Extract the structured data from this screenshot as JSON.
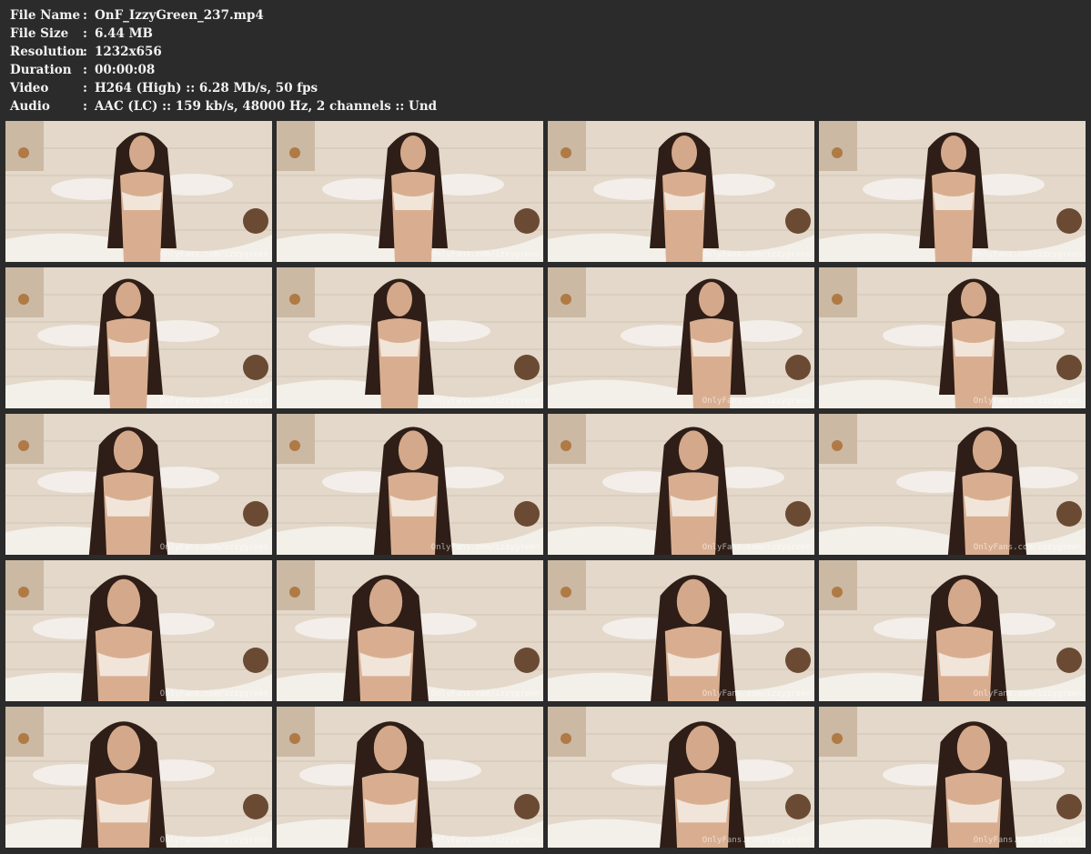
{
  "info": [
    {
      "key": "File Name",
      "sep": ":",
      "value": "OnF_IzzyGreen_237.mp4"
    },
    {
      "key": "File Size",
      "sep": ":",
      "value": "6.44 MB"
    },
    {
      "key": "Resolution",
      "sep": ":",
      "value": "1232x656"
    },
    {
      "key": "Duration",
      "sep": ":",
      "value": "00:00:08"
    },
    {
      "key": "Video",
      "sep": ":",
      "value": "H264 (High) :: 6.28 Mb/s, 50 fps"
    },
    {
      "key": "Audio",
      "sep": ":",
      "value": "AAC (LC) :: 159 kb/s, 48000 Hz, 2 channels :: Und"
    }
  ],
  "thumbnails": {
    "count": 20,
    "columns": 4,
    "rows": 5,
    "watermark": "OnlyFans.com/izzygreen"
  }
}
